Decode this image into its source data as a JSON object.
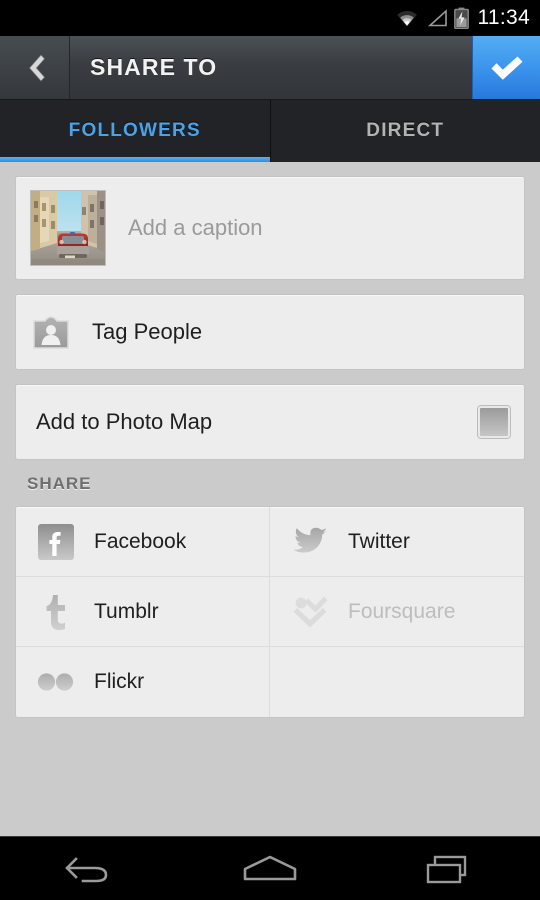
{
  "statusbar": {
    "time": "11:34",
    "icons": [
      "wifi-icon",
      "signal-icon",
      "battery-charging-icon"
    ]
  },
  "actionbar": {
    "back_icon": "chevron-left-icon",
    "title": "SHARE TO",
    "confirm_icon": "check-icon",
    "confirm_color": "#3e97ed"
  },
  "tabs": [
    {
      "label": "FOLLOWERS",
      "active": true,
      "accent": "#4aa3e8"
    },
    {
      "label": "DIRECT",
      "active": false
    }
  ],
  "caption": {
    "placeholder": "Add a caption",
    "thumbnail_name": "photo-thumbnail-street-red-car"
  },
  "rows": [
    {
      "name": "tag-people",
      "label": "Tag People",
      "icon": "person-tag-icon"
    },
    {
      "name": "add-to-photo-map",
      "label": "Add to Photo Map",
      "checkbox": "unchecked"
    }
  ],
  "share": {
    "header": "SHARE",
    "services": [
      {
        "label": "Facebook",
        "icon": "facebook-icon",
        "enabled": true
      },
      {
        "label": "Twitter",
        "icon": "twitter-icon",
        "enabled": true
      },
      {
        "label": "Tumblr",
        "icon": "tumblr-icon",
        "enabled": true
      },
      {
        "label": "Foursquare",
        "icon": "foursquare-icon",
        "enabled": false
      },
      {
        "label": "Flickr",
        "icon": "flickr-icon",
        "enabled": true
      },
      {
        "label": "",
        "icon": "",
        "enabled": false
      }
    ]
  },
  "navbar": {
    "back": "nav-back-icon",
    "home": "nav-home-icon",
    "recents": "nav-recents-icon"
  },
  "colors": {
    "page_background": "#cbcbcb",
    "card_background": "#ededed",
    "accent_blue": "#3e97ed",
    "actionbar": "#393d42",
    "tabbar": "#212326"
  }
}
